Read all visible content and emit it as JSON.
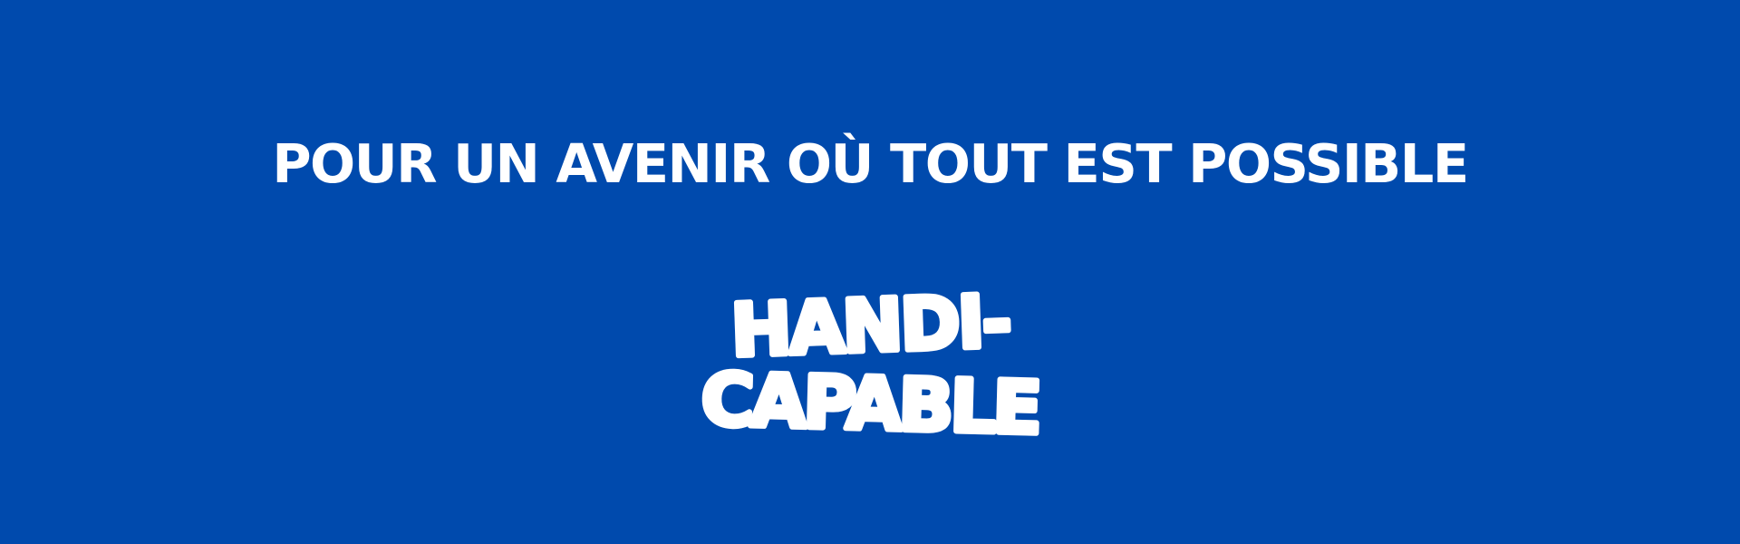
{
  "banner": {
    "background_color": "#004aad",
    "text_color": "#ffffff",
    "headline": "POUR UN AVENIR OÙ TOUT EST POSSIBLE",
    "logo": {
      "line1": "HANDI-",
      "line2": "CAPABLE"
    }
  }
}
